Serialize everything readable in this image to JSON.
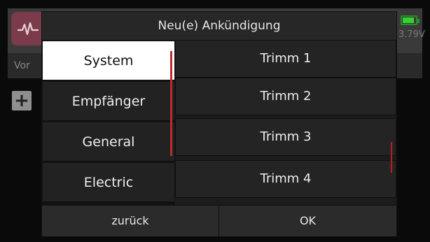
{
  "status": {
    "voltage": "3.79V"
  },
  "background": {
    "back_label": "Vor",
    "plus_label": "+"
  },
  "dialog": {
    "title": "Neu(e) Ankündigung",
    "categories": [
      {
        "label": "System",
        "selected": true
      },
      {
        "label": "Empfänger",
        "selected": false
      },
      {
        "label": "General",
        "selected": false
      },
      {
        "label": "Electric",
        "selected": false
      }
    ],
    "items": [
      "Trimm 1",
      "Trimm 2",
      "Trimm 3",
      "Trimm 4"
    ],
    "buttons": {
      "back": "zurück",
      "ok": "OK"
    }
  },
  "colors": {
    "accent_scroll": "#c02a2a",
    "battery": "#33d233",
    "app_icon": "#7c3b4a"
  }
}
